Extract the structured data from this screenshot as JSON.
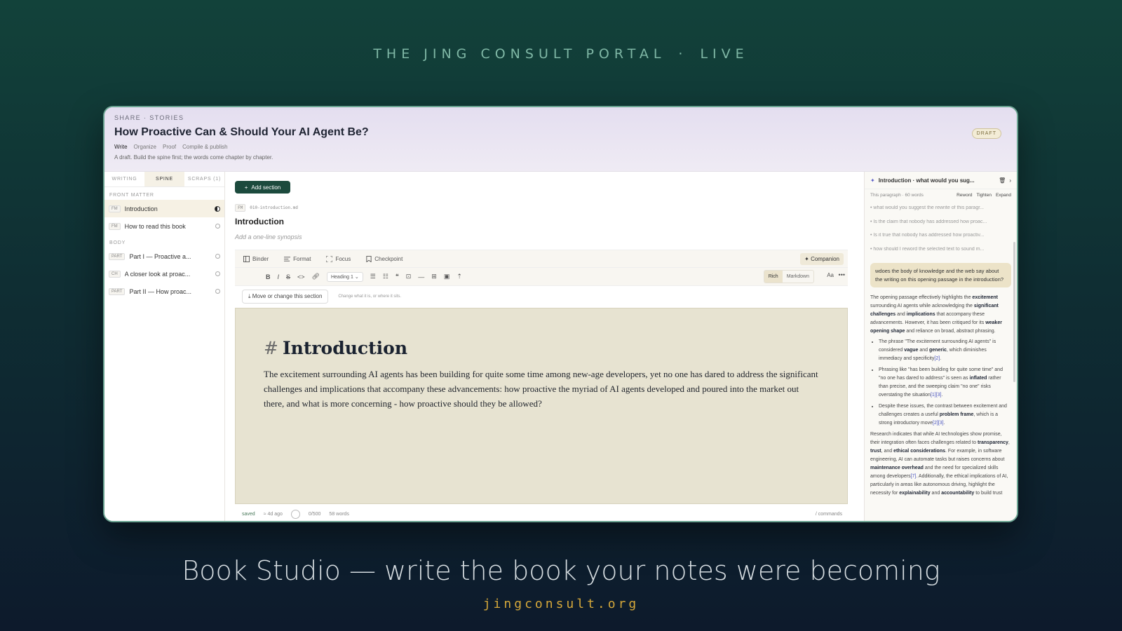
{
  "banner": {
    "left": "THE JING CONSULT PORTAL",
    "sep": "·",
    "right": "LIVE"
  },
  "header": {
    "breadcrumb": "SHARE · STORIES",
    "title": "How Proactive Can & Should Your AI Agent Be?",
    "modes": [
      "Write",
      "Organize",
      "Proof",
      "Compile & publish"
    ],
    "subtitle": "A draft. Build the spine first; the words come chapter by chapter.",
    "status": "DRAFT"
  },
  "sidebar": {
    "tabs": [
      "WRITING",
      "SPINE",
      "SCRAPS (1)"
    ],
    "front_label": "FRONT MATTER",
    "body_label": "BODY",
    "front": [
      {
        "badge": "FM",
        "label": "Introduction"
      },
      {
        "badge": "FM",
        "label": "How to read this book"
      }
    ],
    "body": [
      {
        "badge": "PART",
        "label": "Part I — Proactive a..."
      },
      {
        "badge": "CH",
        "label": "A closer look at proac..."
      },
      {
        "badge": "PART",
        "label": "Part II — How proac..."
      }
    ]
  },
  "editor": {
    "add_section": "Add section",
    "badge": "FM",
    "filename": "010-introduction.md",
    "section_title": "Introduction",
    "synopsis": "Add a one-line synopsis",
    "toolbar": {
      "binder": "Binder",
      "format": "Format",
      "focus": "Focus",
      "checkpoint": "Checkpoint",
      "companion": "Companion"
    },
    "heading_select": "Heading 1",
    "mode_rich": "Rich",
    "mode_markdown": "Markdown",
    "aa": "Aa",
    "move_button": "Move or change this section",
    "move_hint": "Change what it is, or where it sits.",
    "heading_hash": "#",
    "heading": "Introduction",
    "paragraph": "The excitement surrounding AI agents has been building for quite some time among new-age developers, yet no one has dared to address the significant challenges and implications that accompany these advancements: how proactive the myriad of AI agents developed and poured into the market out there, and what is more concerning - how proactive should they be allowed?",
    "status": {
      "saved": "saved",
      "time": "≈ 4d ago",
      "count": "0/500",
      "words": "58 words",
      "commands": "/ commands"
    }
  },
  "companion": {
    "header": "Introduction · what would you sug...",
    "scope": "This paragraph · 60 words",
    "actions": [
      "Reword",
      "Tighten",
      "Expand"
    ],
    "suggestions": [
      "what would you suggest the rewrite of this paragr...",
      "Is the claim that nobody has addressed how proac...",
      "Is it true that nobody has addressed how proactiv...",
      "how should I reword the selected text to sound m..."
    ],
    "question": "wdoes the body of knowledge and the web say about the writing on this opening passage in the introduction?"
  }
}
